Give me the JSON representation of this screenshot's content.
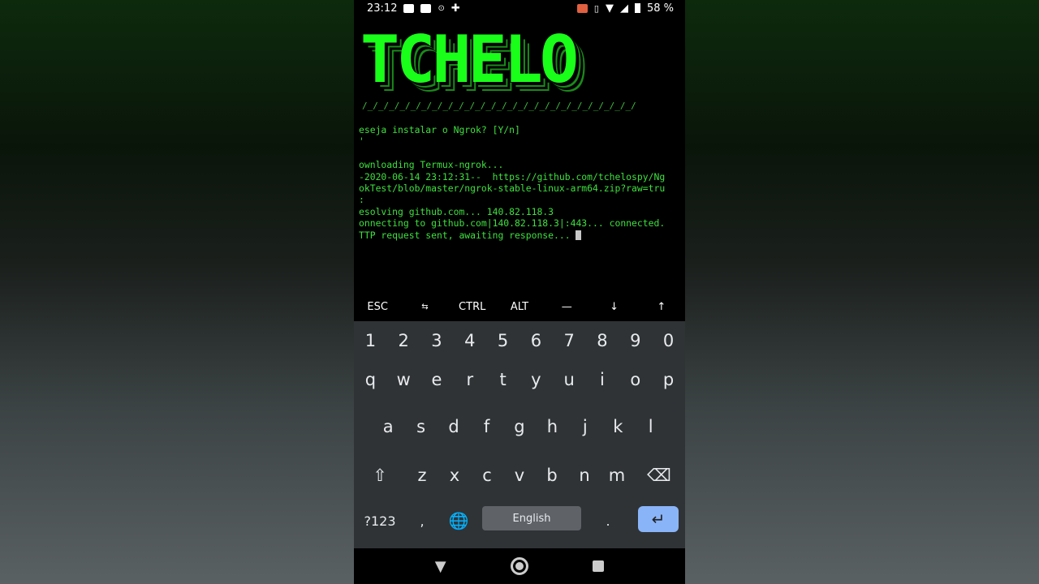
{
  "status_bar": {
    "time": "23:12",
    "battery": "58 %"
  },
  "banner": {
    "text": "TCHELO",
    "underline": "/_/_/_/_/_/_/_/_/_/_/_/_/_/_/_/_/_/_/_/_/_/_/_/_/_/"
  },
  "terminal": {
    "lines": [
      "eseja instalar o Ngrok? [Y/n]",
      "'",
      "",
      "ownloading Termux-ngrok...",
      "-2020-06-14 23:12:31--  https://github.com/tchelospy/Ng",
      "okTest/blob/master/ngrok-stable-linux-arm64.zip?raw=tru",
      ":",
      "esolving github.com... 140.82.118.3",
      "onnecting to github.com|140.82.118.3|:443... connected.",
      "TTP request sent, awaiting response... "
    ]
  },
  "extra_keys": [
    "ESC",
    "⇆",
    "CTRL",
    "ALT",
    "—",
    "↓",
    "↑"
  ],
  "keyboard": {
    "numbers": [
      "1",
      "2",
      "3",
      "4",
      "5",
      "6",
      "7",
      "8",
      "9",
      "0"
    ],
    "row1": [
      "q",
      "w",
      "e",
      "r",
      "t",
      "y",
      "u",
      "i",
      "o",
      "p"
    ],
    "row2": [
      "a",
      "s",
      "d",
      "f",
      "g",
      "h",
      "j",
      "k",
      "l"
    ],
    "row3": [
      "z",
      "x",
      "c",
      "v",
      "b",
      "n",
      "m"
    ],
    "symbols": "?123",
    "comma": ",",
    "space": "English",
    "period": "."
  },
  "colors": {
    "terminal_text": "#3ee03e",
    "banner": "#1aff1a",
    "enter": "#8ab4f8"
  }
}
